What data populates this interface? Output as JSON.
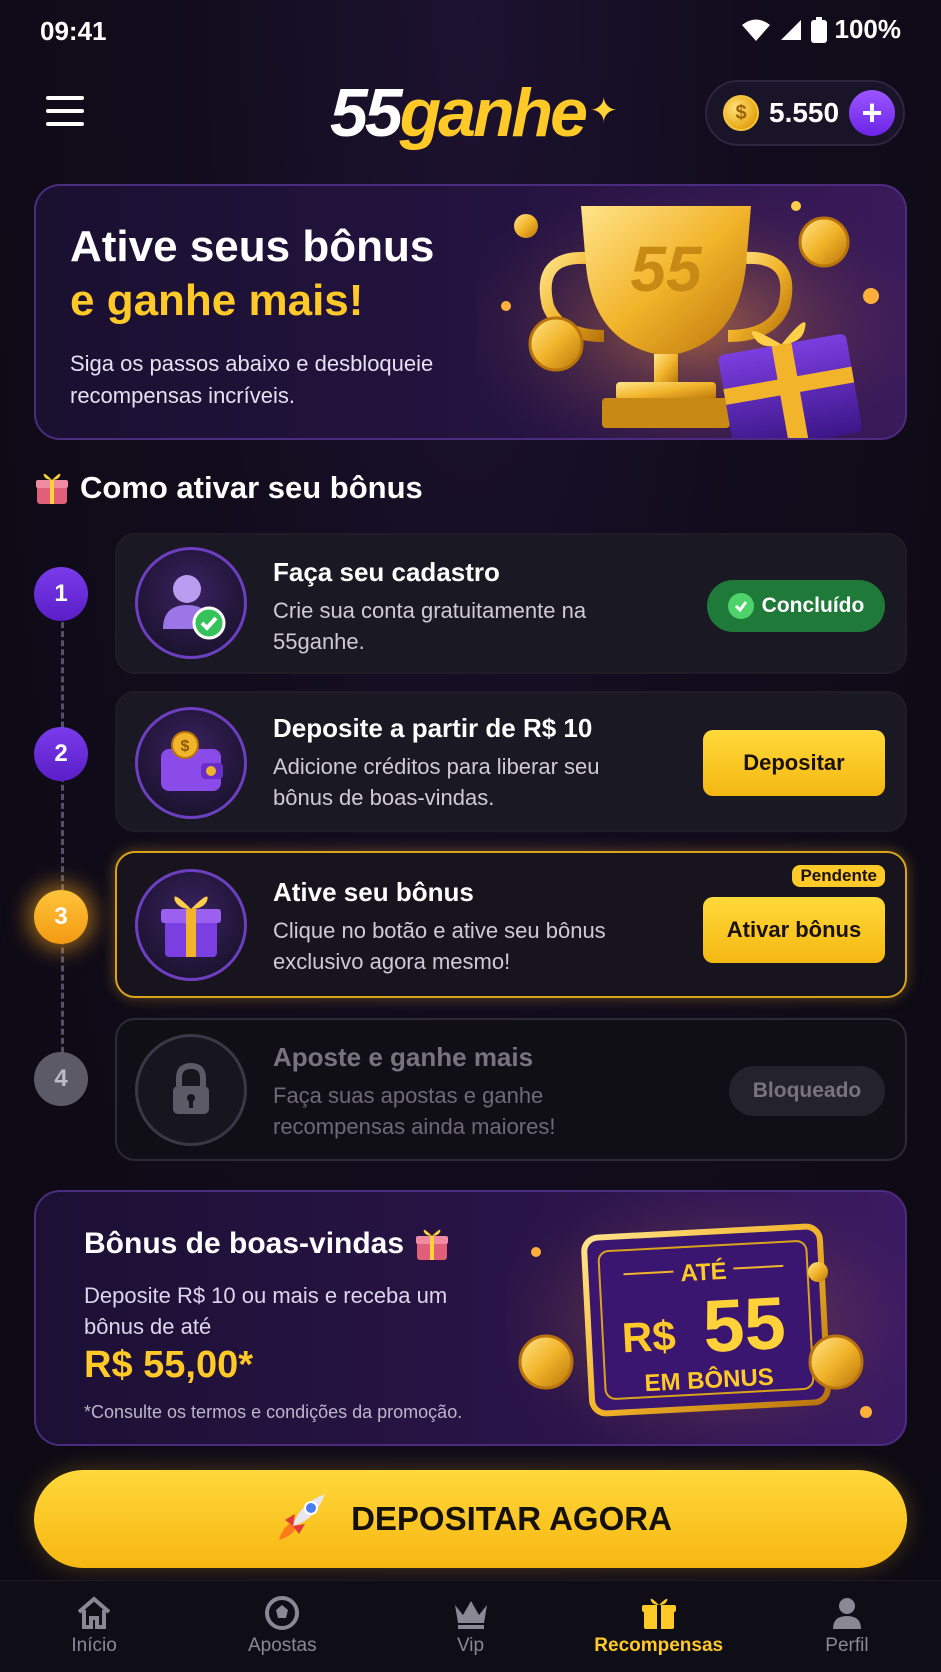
{
  "status_bar": {
    "time": "09:41",
    "battery": "100%"
  },
  "header": {
    "logo": {
      "part1": "55",
      "part2": "ganhe"
    },
    "balance": "5.550",
    "coin_symbol": "$"
  },
  "hero": {
    "title_line1": "Ative seus bônus",
    "title_line2": "e ganhe mais!",
    "subtitle": "Siga os passos abaixo e desbloqueie recompensas incríveis.",
    "trophy_text": "55"
  },
  "section": {
    "title": "Como ativar seu bônus"
  },
  "steps": [
    {
      "number": "1",
      "title": "Faça seu cadastro",
      "description": "Crie sua conta gratuitamente na 55ganhe.",
      "action": "Concluído",
      "state": "done"
    },
    {
      "number": "2",
      "title": "Deposite a partir de R$ 10",
      "description": "Adicione créditos para liberar seu bônus de boas-vindas.",
      "action": "Depositar",
      "state": "available"
    },
    {
      "number": "3",
      "title": "Ative seu bônus",
      "description": "Clique no botão e ative seu bônus exclusivo agora mesmo!",
      "action": "Ativar bônus",
      "badge": "Pendente",
      "state": "pending"
    },
    {
      "number": "4",
      "title": "Aposte e ganhe mais",
      "description": "Faça suas apostas e ganhe recompensas ainda maiores!",
      "action": "Bloqueado",
      "state": "locked"
    }
  ],
  "welcome_bonus": {
    "title": "Bônus de boas-vindas",
    "description": "Deposite R$ 10 ou mais e receba um bônus de até",
    "amount": "R$ 55,00*",
    "terms": "*Consulte os termos e condições da promoção.",
    "ticket_top": "ATÉ",
    "ticket_currency": "R$",
    "ticket_value": "55",
    "ticket_bottom": "EM BÔNUS"
  },
  "cta": {
    "label": "DEPOSITAR AGORA"
  },
  "bottom_nav": [
    {
      "label": "Início",
      "icon": "home-icon",
      "active": false
    },
    {
      "label": "Apostas",
      "icon": "soccer-ball-icon",
      "active": false
    },
    {
      "label": "Vip",
      "icon": "crown-icon",
      "active": false
    },
    {
      "label": "Recompensas",
      "icon": "gift-icon",
      "active": true
    },
    {
      "label": "Perfil",
      "icon": "user-icon",
      "active": false
    }
  ],
  "colors": {
    "accent_yellow": "#ffc928",
    "accent_purple": "#7a3bea",
    "success_green": "#1f7a3a",
    "background": "#110c1c"
  }
}
